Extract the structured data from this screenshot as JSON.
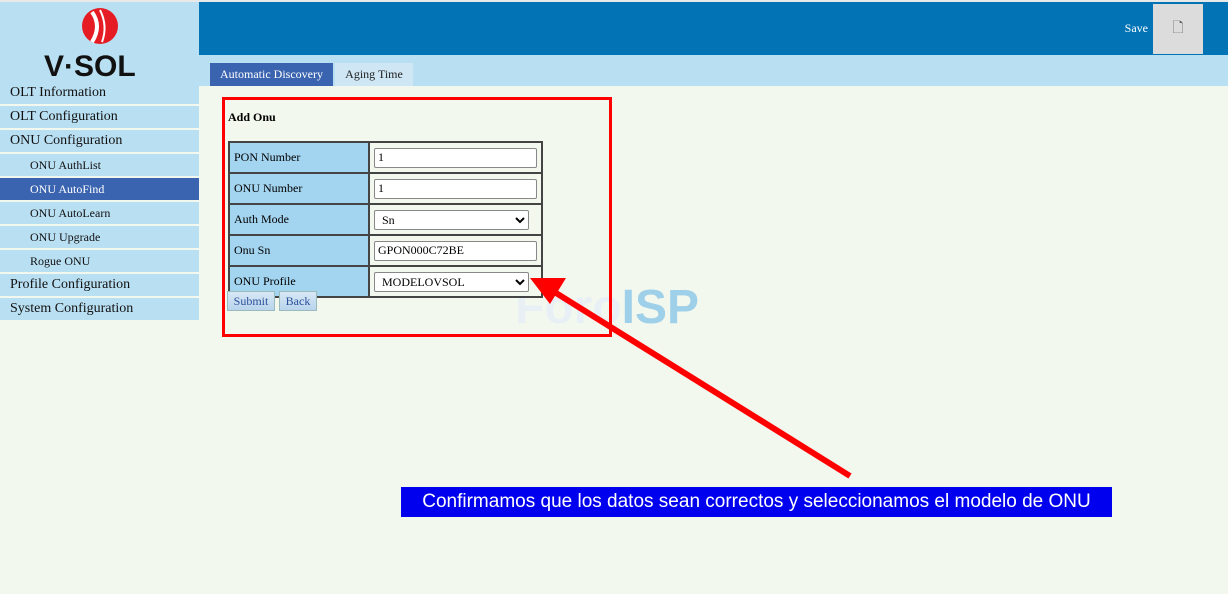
{
  "brand": {
    "logo_text": "V·SOL"
  },
  "header": {
    "save_label": "Save",
    "save_icon": "file-icon"
  },
  "tabs": [
    {
      "label": "Automatic Discovery",
      "active": true
    },
    {
      "label": "Aging Time",
      "active": false
    }
  ],
  "sidebar": {
    "items": [
      {
        "label": "OLT Information"
      },
      {
        "label": "OLT Configuration"
      },
      {
        "label": "ONU Configuration"
      },
      {
        "label": "ONU AuthList"
      },
      {
        "label": "ONU AutoFind",
        "selected": true
      },
      {
        "label": "ONU AutoLearn"
      },
      {
        "label": "ONU Upgrade"
      },
      {
        "label": "Rogue ONU"
      },
      {
        "label": "Profile Configuration"
      },
      {
        "label": "System Configuration"
      }
    ]
  },
  "form": {
    "title": "Add Onu",
    "fields": [
      {
        "label": "PON Number",
        "value": "1"
      },
      {
        "label": "ONU Number",
        "value": "1"
      },
      {
        "label": "Auth Mode",
        "value": "Sn"
      },
      {
        "label": "Onu Sn",
        "value": "GPON000C72BE"
      },
      {
        "label": "ONU Profile",
        "value": "MODELOVSOL"
      }
    ],
    "submit": "Submit",
    "back": "Back"
  },
  "watermark": {
    "text_a": "Foro",
    "text_b": "ISP"
  },
  "annotation": {
    "caption": "Confirmamos que los datos sean correctos y seleccionamos el modelo de ONU",
    "highlight_color": "#ff0000",
    "caption_bg": "#0000ee"
  }
}
